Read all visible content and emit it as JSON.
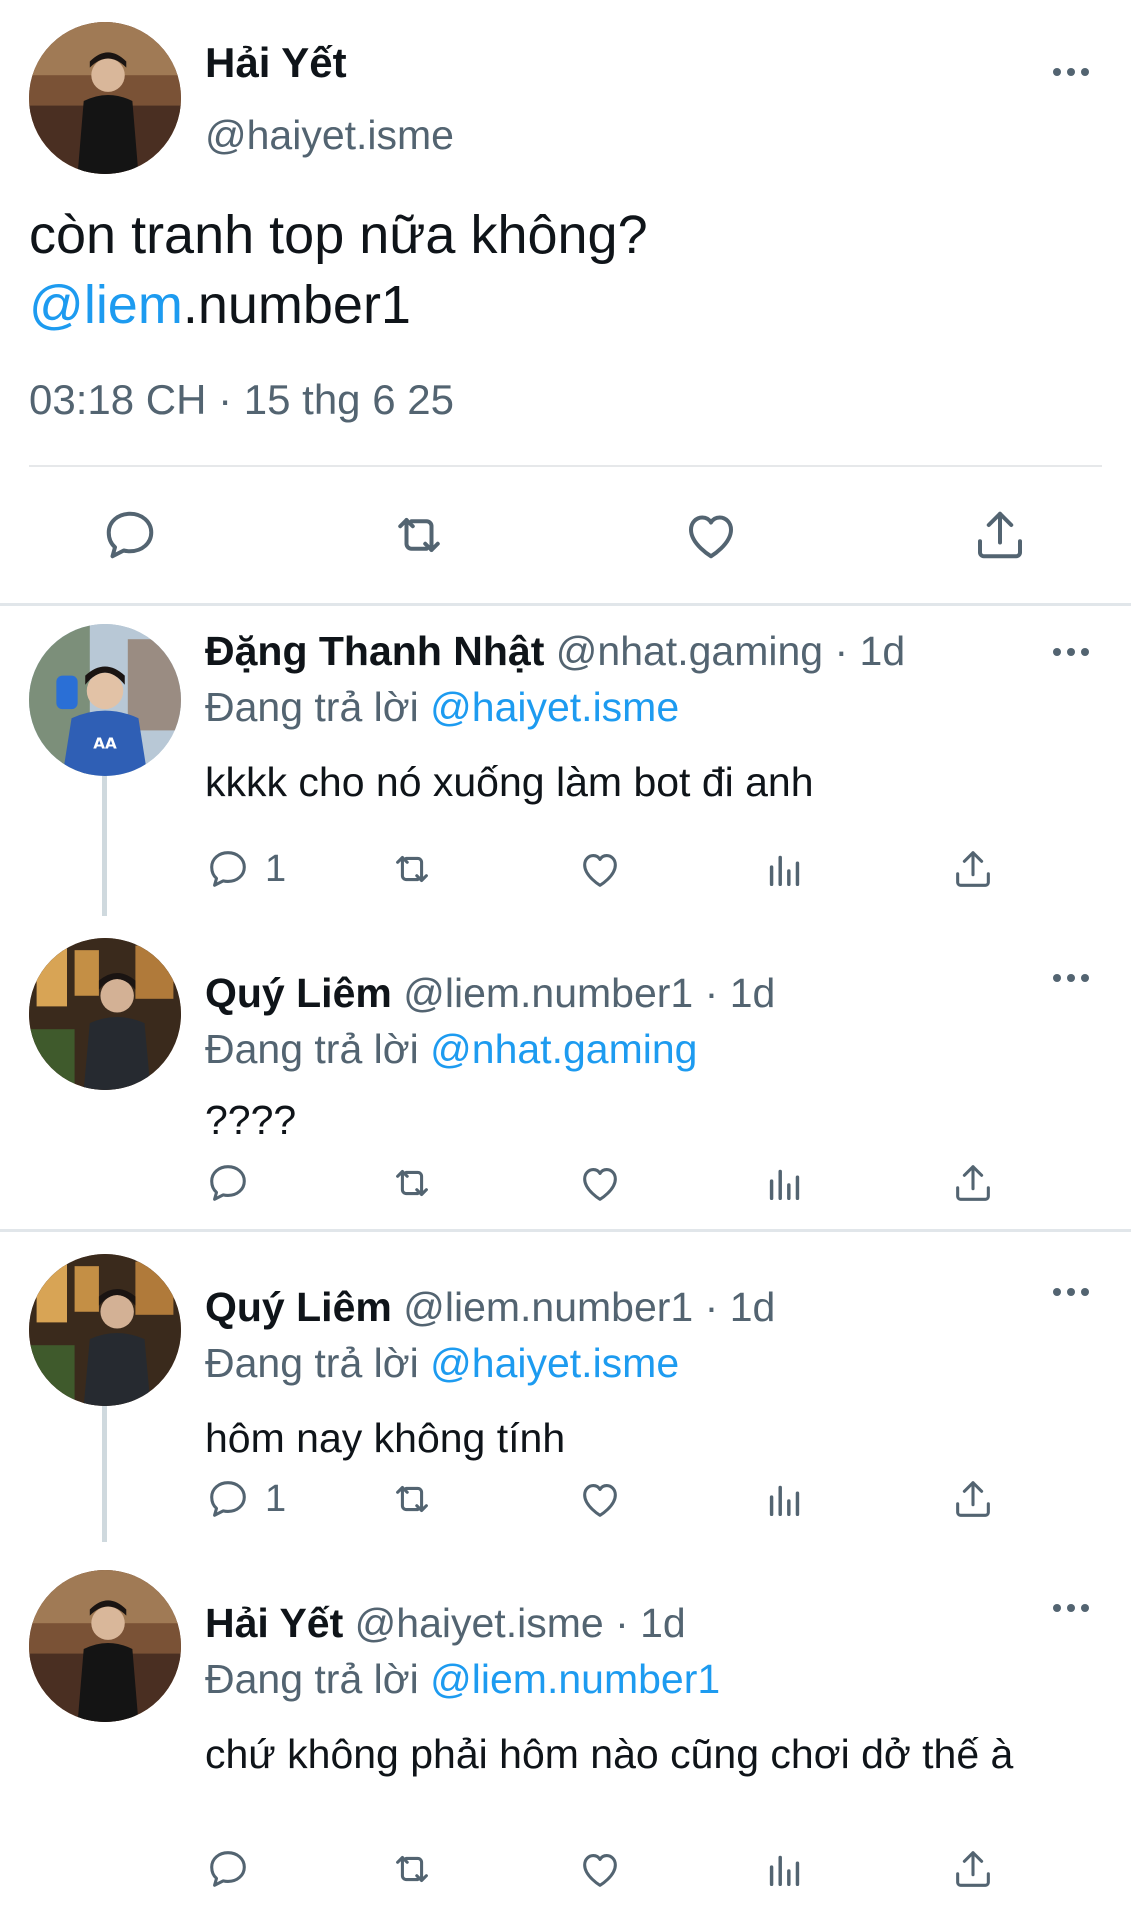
{
  "main_tweet": {
    "name": "Hải Yết",
    "handle": "@haiyet.isme",
    "text_line1": "còn tranh top nữa không?",
    "mention": "@liem",
    "text_after_mention": ".number1",
    "timestamp": "03:18 CH · 15 thg 6 25",
    "icons": [
      "reply-icon",
      "retweet-icon",
      "like-icon",
      "share-icon"
    ]
  },
  "replies": [
    {
      "name": "Đặng Thanh Nhật",
      "handle": "@nhat.gaming",
      "time": "· 1d",
      "replying_label": "Đang trả lời",
      "replying_to": "@haiyet.isme",
      "text": "kkkk cho nó xuống làm bot đi anh",
      "reply_count": "1"
    },
    {
      "name": "Quý Liêm",
      "handle": "@liem.number1",
      "time": "· 1d",
      "replying_label": "Đang trả lời",
      "replying_to": "@nhat.gaming",
      "text": "????",
      "reply_count": ""
    },
    {
      "name": "Quý Liêm",
      "handle": "@liem.number1",
      "time": "· 1d",
      "replying_label": "Đang trả lời",
      "replying_to": "@haiyet.isme",
      "text": "hôm nay không tính",
      "reply_count": "1"
    },
    {
      "name": "Hải Yết",
      "handle": "@haiyet.isme",
      "time": "· 1d",
      "replying_label": "Đang trả lời",
      "replying_to": "@liem.number1",
      "text": "chứ không phải hôm nào cũng chơi dở thế à",
      "reply_count": ""
    }
  ],
  "colors": {
    "accent": "#1d9bf0",
    "secondary_text": "#536471",
    "primary_text": "#0f1419"
  }
}
